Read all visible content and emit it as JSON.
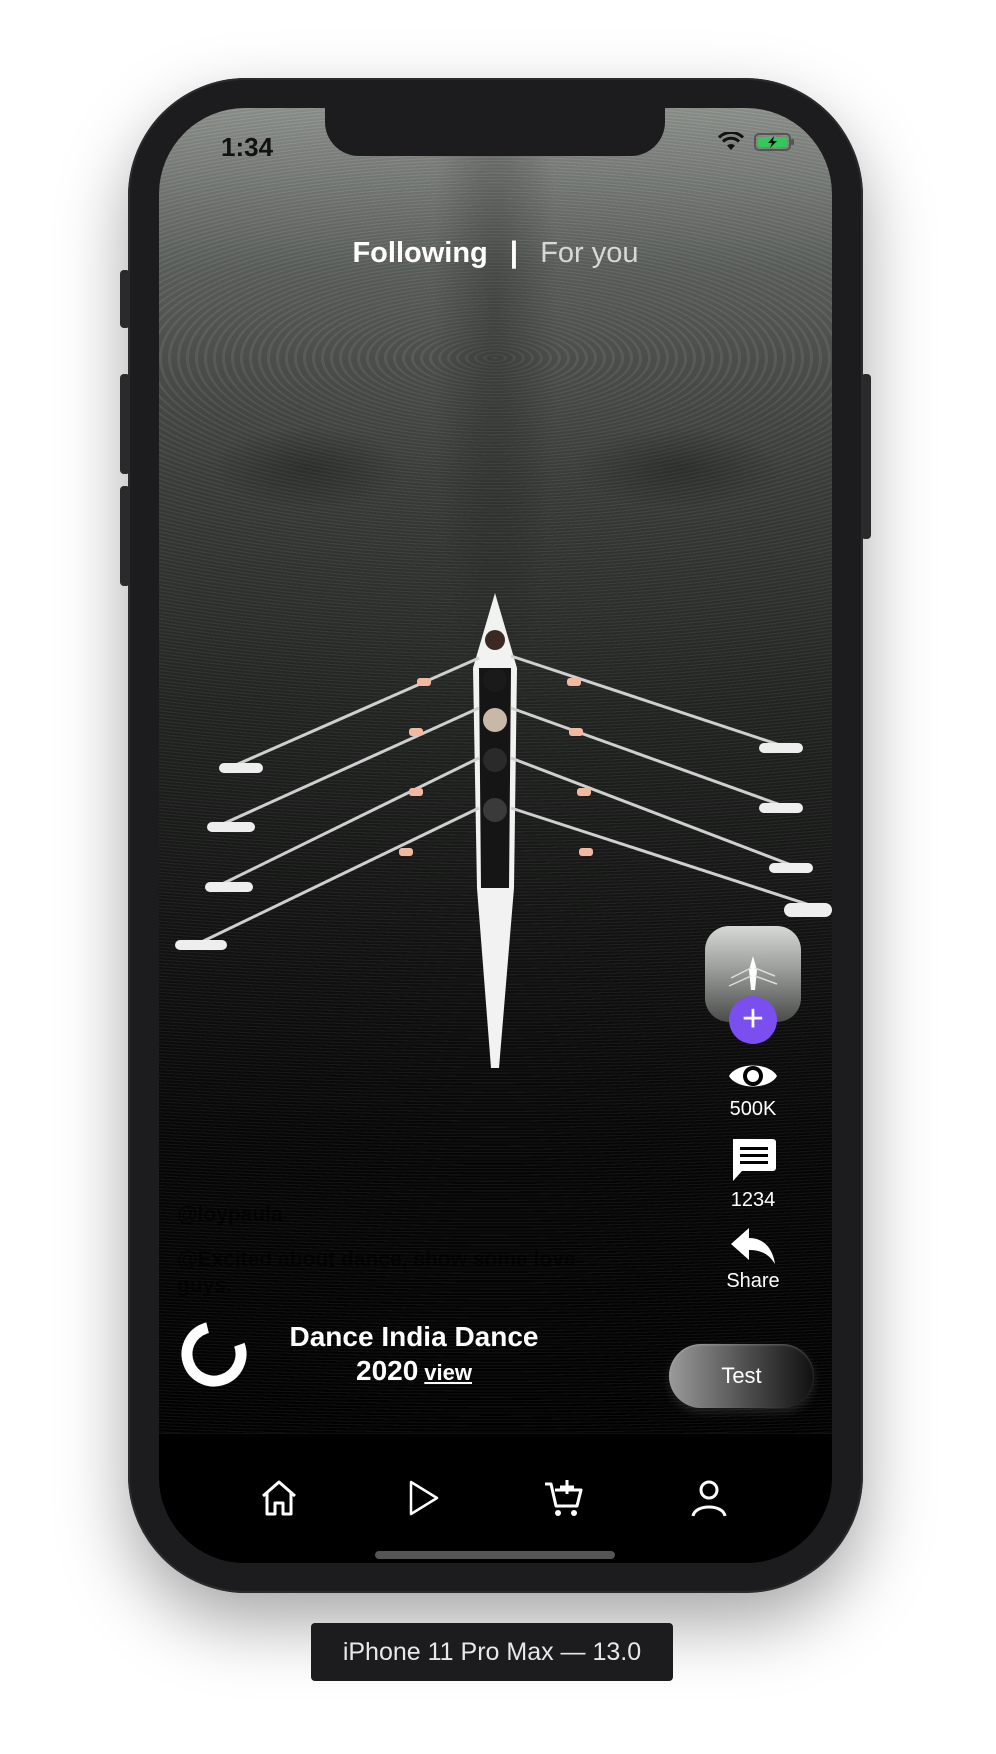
{
  "status_bar": {
    "time": "1:34",
    "wifi_icon": "wifi-icon",
    "battery_icon": "battery-charging-icon"
  },
  "tabs": {
    "following": "Following",
    "separator": "|",
    "for_you": "For you"
  },
  "right_rail": {
    "follow_icon": "plus-icon",
    "views": {
      "icon": "eye-icon",
      "count": "500K"
    },
    "comments": {
      "icon": "comment-icon",
      "count": "1234"
    },
    "share": {
      "icon": "share-reply-icon",
      "label": "Share"
    }
  },
  "caption": {
    "handle": "@loypaula",
    "description": "@Excited about dance, show some love guys."
  },
  "promo": {
    "title_line1": "Dance India Dance",
    "title_line2": "2020",
    "link_label": "view "
  },
  "test_button": {
    "label": "Test"
  },
  "bottom_nav": [
    {
      "icon": "home-icon"
    },
    {
      "icon": "play-icon"
    },
    {
      "icon": "cart-add-icon"
    },
    {
      "icon": "user-icon"
    }
  ],
  "device_label": "iPhone 11 Pro Max — 13.0",
  "colors": {
    "accent": "#7b4ef0",
    "frame": "#1c1c1e"
  }
}
